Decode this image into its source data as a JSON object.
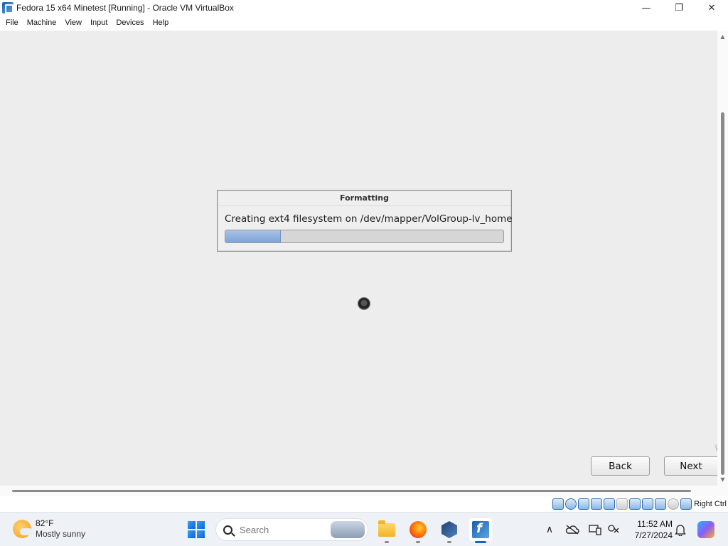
{
  "window": {
    "title": "Fedora 15 x64 Minetest [Running] - Oracle VM VirtualBox",
    "minimize_glyph": "—",
    "maximize_glyph": "❐",
    "close_glyph": "✕"
  },
  "menu": [
    "File",
    "Machine",
    "View",
    "Input",
    "Devices",
    "Help"
  ],
  "vm": {
    "dialog": {
      "title": "Formatting",
      "message": "Creating ext4 filesystem on /dev/mapper/VolGroup-lv_home",
      "progress": 0.2
    },
    "buttons": {
      "back": "Back",
      "next": "Next"
    }
  },
  "statusbar": {
    "icons": [
      "hard-disk-icon",
      "optical-drive-icon",
      "audio-icon",
      "network-icon",
      "usb-icon",
      "shared-folders-icon",
      "display-icon",
      "recording-icon",
      "video-capture-icon",
      "mouse-integration-icon",
      "keyboard-icon"
    ],
    "host_key": "Right Ctrl"
  },
  "taskbar": {
    "weather": {
      "temp": "82°F",
      "condition": "Mostly sunny"
    },
    "search": {
      "placeholder": "Search"
    },
    "apps": [
      "file-explorer-icon",
      "firefox-icon",
      "virtualbox-icon",
      "fedora-vm-icon"
    ],
    "tray": {
      "chevron_glyph": "∧",
      "time": "11:52 AM",
      "date": "7/27/2024"
    }
  }
}
